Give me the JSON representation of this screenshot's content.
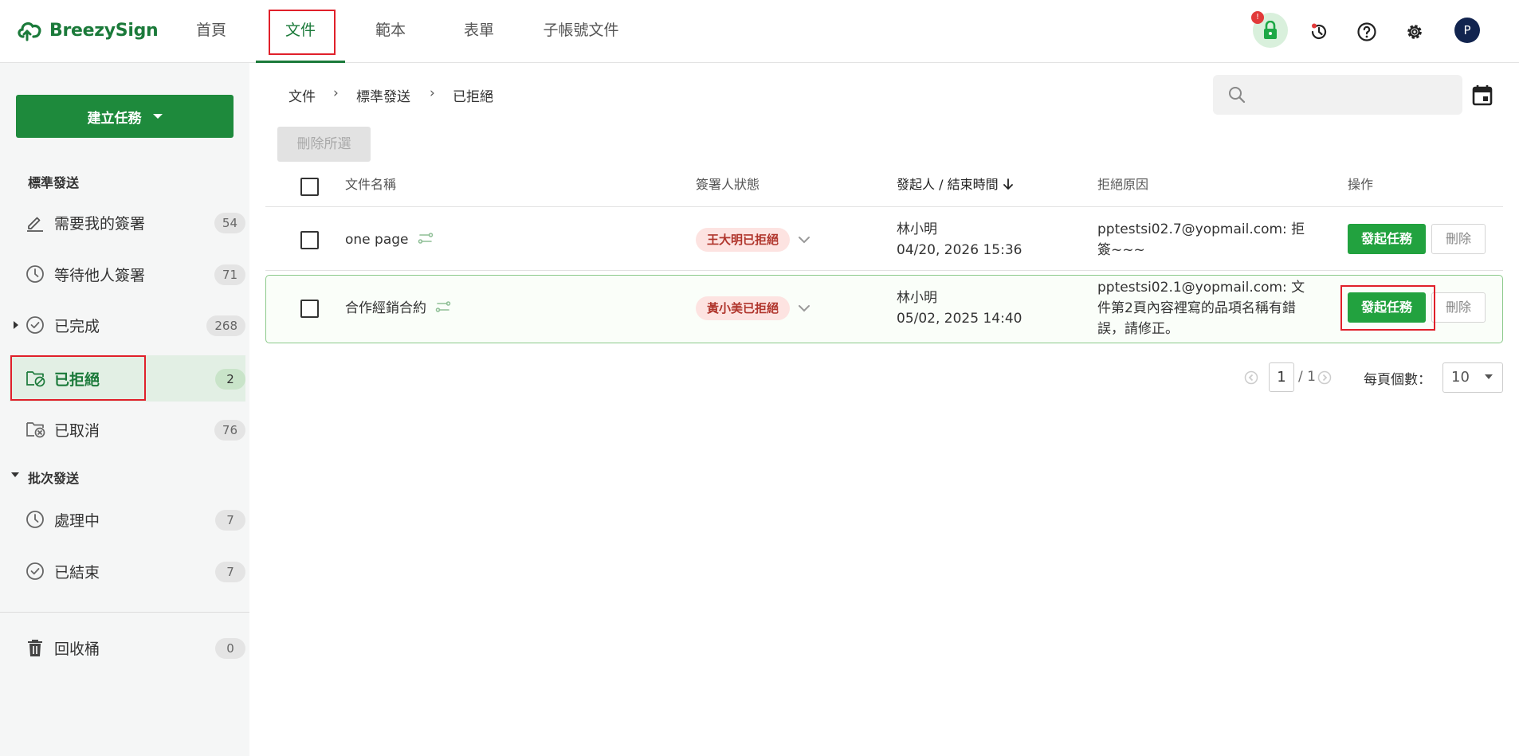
{
  "app": {
    "name": "BreezySign",
    "brand_color": "#1b7a3a",
    "accent_green": "#22a23f"
  },
  "nav": {
    "tabs": [
      {
        "label": "首頁"
      },
      {
        "label": "文件",
        "active": true
      },
      {
        "label": "範本"
      },
      {
        "label": "表單"
      },
      {
        "label": "子帳號文件"
      }
    ]
  },
  "header": {
    "icons": [
      "lock-icon",
      "history-icon",
      "help-icon",
      "settings-icon"
    ],
    "avatar_initial": "P"
  },
  "sidebar": {
    "create_button": "建立任務",
    "sections": [
      {
        "title": "標準發送",
        "items": [
          {
            "label": "需要我的簽署",
            "count": "54",
            "icon": "pen-icon"
          },
          {
            "label": "等待他人簽署",
            "count": "71",
            "icon": "clock-icon"
          },
          {
            "label": "已完成",
            "count": "268",
            "icon": "check-circle-icon"
          },
          {
            "label": "已拒絕",
            "count": "2",
            "icon": "folder-rejected-icon",
            "active": true
          },
          {
            "label": "已取消",
            "count": "76",
            "icon": "folder-cancel-icon"
          }
        ]
      },
      {
        "title": "批次發送",
        "items": [
          {
            "label": "處理中",
            "count": "7",
            "icon": "clock-icon"
          },
          {
            "label": "已結束",
            "count": "7",
            "icon": "check-circle-icon"
          }
        ]
      }
    ],
    "trash": {
      "label": "回收桶",
      "count": "0"
    }
  },
  "breadcrumb": [
    "文件",
    "標準發送",
    "已拒絕"
  ],
  "toolbar": {
    "delete_selected": "刪除所選"
  },
  "table": {
    "headers": [
      "文件名稱",
      "簽署人狀態",
      "發起人 / 結束時間",
      "拒絕原因",
      "操作"
    ],
    "rows": [
      {
        "name": "one page",
        "status": "王大明已拒絕",
        "initiator": "林小明",
        "time": "04/20, 2026 15:36",
        "reason": [
          "pptestsi02.7@yopmail.com: 拒",
          "簽~~~"
        ],
        "action": "發起任務",
        "delete": "刪除"
      },
      {
        "name": "合作經銷合約",
        "status": "黃小美已拒絕",
        "initiator": "林小明",
        "time": "05/02, 2025 14:40",
        "reason": [
          "pptestsi02.1@yopmail.com: 文",
          "件第2頁內容裡寫的品項名稱有錯",
          "誤，請修正。"
        ],
        "action": "發起任務",
        "delete": "刪除"
      }
    ]
  },
  "pagination": {
    "current": "1",
    "total": "/ 1",
    "per_page_label": "每頁個數：",
    "per_page": "10"
  }
}
